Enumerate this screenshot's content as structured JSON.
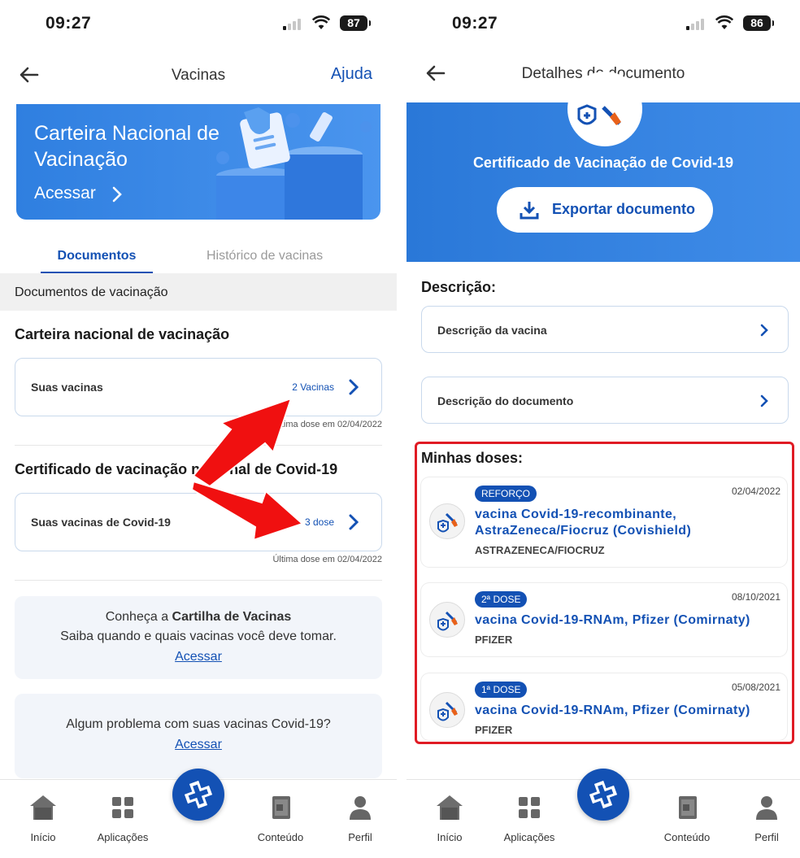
{
  "left": {
    "status": {
      "time": "09:27",
      "battery": "87"
    },
    "header": {
      "title": "Vacinas",
      "help": "Ajuda"
    },
    "banner": {
      "title": "Carteira Nacional de Vacinação",
      "link": "Acessar"
    },
    "tabs": {
      "active": "Documentos",
      "inactive": "Histórico de vacinas"
    },
    "section_bar": "Documentos de vacinação",
    "carteira": {
      "heading": "Carteira nacional de vacinação",
      "row_label": "Suas vacinas",
      "count": "2 Vacinas",
      "note": "Última dose em 02/04/2022"
    },
    "certificado": {
      "heading": "Certificado de vacinação nacional de Covid-19",
      "row_label": "Suas vacinas de Covid-19",
      "count": "3 dose",
      "note": "Última dose em 02/04/2022"
    },
    "cartilha": {
      "prefix": "Conheça a ",
      "bold": "Cartilha de Vacinas",
      "line2": "Saiba quando e quais vacinas você deve tomar.",
      "link": "Acessar"
    },
    "problema": {
      "line": "Algum problema com suas vacinas Covid-19?",
      "link": "Acessar"
    }
  },
  "right": {
    "status": {
      "time": "09:27",
      "battery": "86"
    },
    "header": {
      "title": "Detalhes do documento"
    },
    "banner": {
      "title": "Certificado de Vacinação de Covid-19",
      "export": "Exportar documento"
    },
    "descricao": {
      "heading": "Descrição:",
      "items": [
        "Descrição da vacina",
        "Descrição do documento"
      ]
    },
    "doses": {
      "heading": "Minhas doses:",
      "items": [
        {
          "badge": "REFORÇO",
          "date": "02/04/2022",
          "name": "vacina Covid-19-recombinante, AstraZeneca/Fiocruz (Covishield)",
          "maker": "ASTRAZENECA/FIOCRUZ"
        },
        {
          "badge": "2ª DOSE",
          "date": "08/10/2021",
          "name": "vacina Covid-19-RNAm, Pfizer (Comirnaty)",
          "maker": "PFIZER"
        },
        {
          "badge": "1ª DOSE",
          "date": "05/08/2021",
          "name": "vacina Covid-19-RNAm, Pfizer (Comirnaty)",
          "maker": "PFIZER"
        }
      ]
    }
  },
  "nav": [
    "Início",
    "Aplicações",
    "Conteúdo",
    "Perfil"
  ],
  "colors": {
    "primary": "#1351b4",
    "banner": "#2f7fe0",
    "highlight": "#e01b24"
  }
}
